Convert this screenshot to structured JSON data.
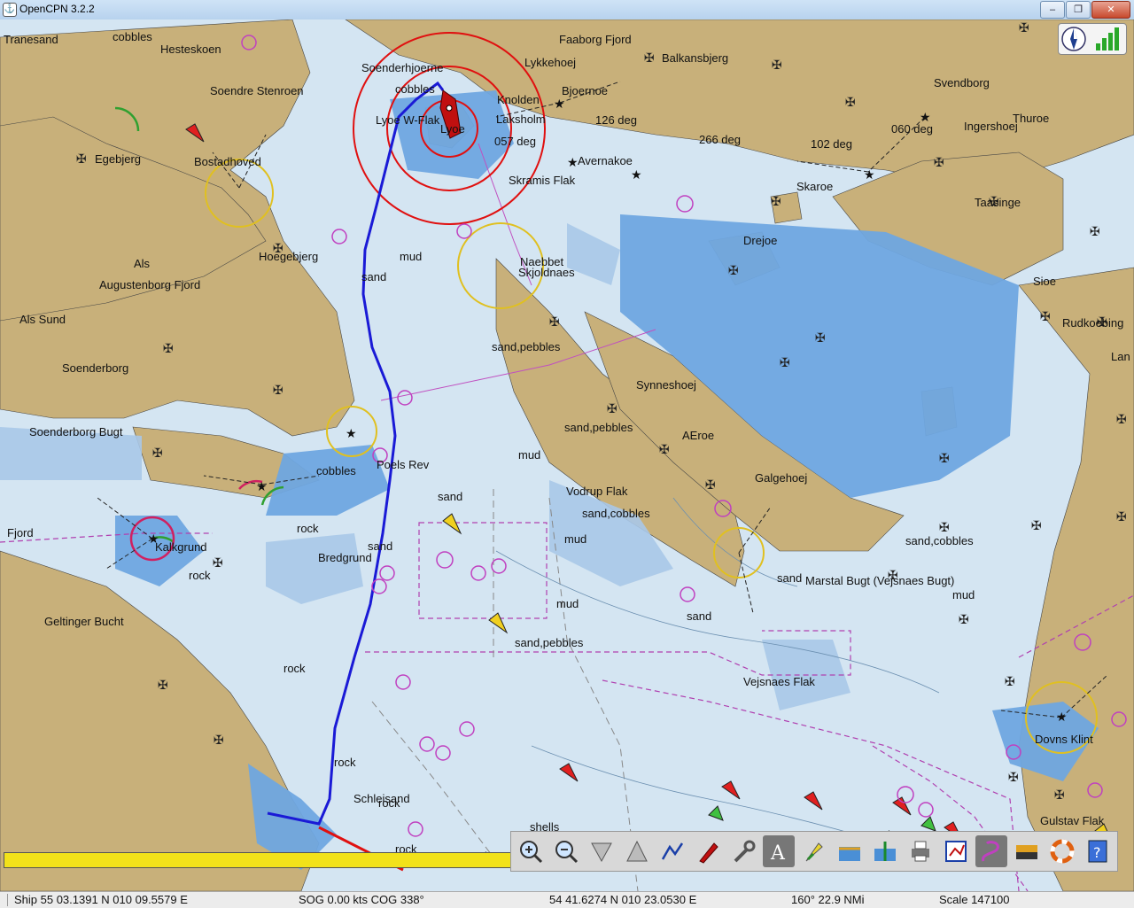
{
  "window": {
    "title": "OpenCPN 3.2.2",
    "buttons": [
      "–",
      "❐",
      "✕"
    ]
  },
  "chart_labels": [
    "Tranesand",
    "cobbles",
    "Hesteskoen",
    "Soendre Stenroen",
    "Egebjerg",
    "Bostadhoved",
    "Hoegebjerg",
    "Als",
    "Augustenborg Fjord",
    "Als Sund",
    "Soenderborg",
    "Soenderborg Bugt",
    "Fjord",
    "Kalkgrund",
    "rock",
    "Geltinger Bucht",
    "rock",
    "rock",
    "Schleisand",
    "rock",
    "rock",
    "rock",
    "Soenderhjoerne",
    "cobbles",
    "Lyoe W-Flak",
    "Lyoe",
    "Knolden",
    "Laksholm",
    "057 deg",
    "Faaborg Fjord",
    "Lykkehoej",
    "Balkansbjerg",
    "Bjoernoe",
    "126 deg",
    "Avernakoe",
    "Skramis Flak",
    "266 deg",
    "102 deg",
    "060 deg",
    "Svendborg",
    "Thuroe",
    "Ingershoej",
    "Skaroe",
    "Taasinge",
    "Drejoe",
    "Naebbet",
    "Skjoldnaes",
    "mud",
    "sand",
    "sand,pebbles",
    "Synneshoej",
    "Sioe",
    "Rudkoebing",
    "Lan",
    "sand,pebbles",
    "AEroe",
    "Galgehoej",
    "Poels Rev",
    "cobbles",
    "mud",
    "sand",
    "Vodrup Flak",
    "sand,cobbles",
    "rock",
    "Bredgrund",
    "sand",
    "mud",
    "mud",
    "sand,pebbles",
    "sand,cobbles",
    "sand",
    "Marstal Bugt (Vejsnaes Bugt)",
    "mud",
    "sand",
    "Vejsnaes Flak",
    "Dovns Klint",
    "shells",
    "rock",
    "Gulstav Flak",
    "rock"
  ],
  "toolbar": {
    "buttons": [
      "zoom-in-icon",
      "zoom-out-icon",
      "scale-in-icon",
      "scale-out-icon",
      "route-icon",
      "ship-follow-icon",
      "settings-icon",
      "text-icon",
      "current-icon",
      "tide-icon",
      "currents-icon",
      "print-icon",
      "route-manager-icon",
      "track-icon",
      "color-scheme-icon",
      "mob-icon",
      "help-icon"
    ]
  },
  "progress": {
    "fraction": 1.0
  },
  "status": {
    "ship": "Ship 55 03.1391 N   010 09.5579 E",
    "sog": "SOG 0.00 kts   COG 338°",
    "cursor": "54 41.6274 N   010 23.0530 E",
    "bearing": "160°   22.9 NMi",
    "scale": "Scale 147100"
  },
  "colors": {
    "land": "#c8b07a",
    "shallow": "#6fa6e0",
    "medium": "#a8c8e8",
    "deep": "#d4e5f2",
    "track": "#1a1ad6"
  }
}
